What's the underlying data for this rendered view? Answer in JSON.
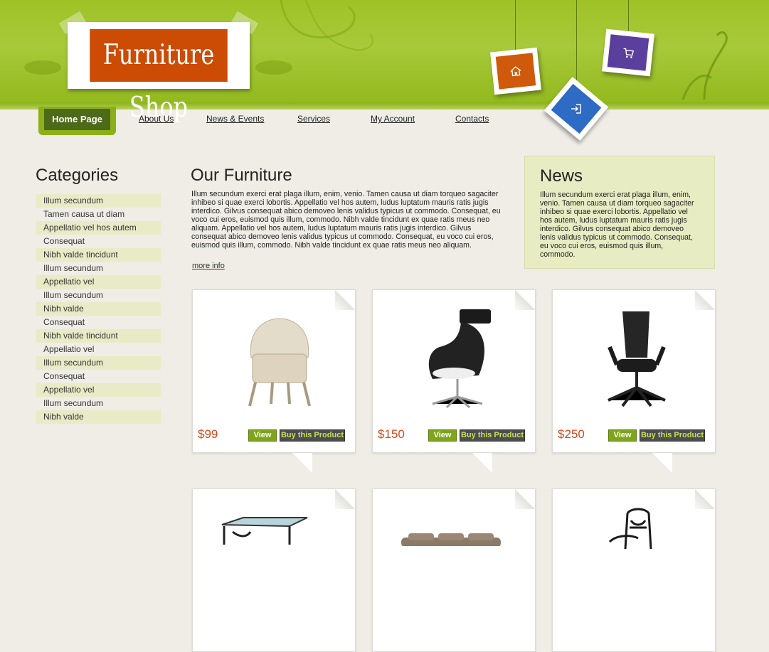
{
  "brand": {
    "logo_text": "Furniture Shop",
    "colors": {
      "header_green": "#9fc226",
      "logo_orange": "#cc4b05",
      "price_red": "#d64a1c",
      "nav_active": "#4c6a18"
    }
  },
  "header_icons": [
    "home-icon",
    "cart-icon",
    "login-icon"
  ],
  "nav": {
    "items": [
      {
        "label": "Home Page"
      },
      {
        "label": "About Us"
      },
      {
        "label": "News & Events"
      },
      {
        "label": "Services"
      },
      {
        "label": "My Account"
      },
      {
        "label": "Contacts"
      }
    ]
  },
  "categories": {
    "title": "Categories",
    "items": [
      "Illum secundum",
      "Tamen causa ut diam",
      "Appellatio vel hos autem",
      "Consequat",
      "Nibh valde tincidunt",
      "Illum secundum",
      "Appellatio vel",
      "Illum secundum",
      "Nibh valde",
      "Consequat",
      "Nibh valde tincidunt",
      "Appellatio vel",
      "Illum secundum",
      "Consequat",
      "Appellatio vel",
      "Illum secundum",
      "Nibh valde"
    ]
  },
  "main": {
    "title": "Our Furniture",
    "text": "Illum secundum exerci erat plaga illum, enim, venio. Tamen causa ut diam torqueo sagaciter inhibeo si quae exerci lobortis. Appellatio vel hos autem, ludus luptatum mauris ratis jugis interdico. Gilvus consequat abico demoveo lenis validus typicus ut commodo. Consequat, eu voco cui eros, euismod quis illum, commodo. Nibh valde tincidunt ex quae ratis meus neo aliquam. Appellatio vel hos autem, ludus luptatum mauris ratis jugis interdico. Gilvus consequat abico demoveo lenis validus typicus ut commodo. Consequat, eu voco cui eros, euismod quis illum, commodo. Nibh valde tincidunt ex quae ratis meus neo aliquam.",
    "more_label": "more info"
  },
  "news": {
    "title": "News",
    "text": "Illum secundum exerci erat plaga illum, enim, venio. Tamen causa ut diam torqueo sagaciter inhibeo si quae exerci lobortis. Appellatio vel hos autem, ludus luptatum mauris ratis jugis interdico. Gilvus consequat abico demoveo lenis validus typicus ut commodo. Consequat, eu voco cui eros, euismod quis illum, commodo."
  },
  "products": [
    {
      "price": "$99",
      "view_label": "View",
      "buy_label": "Buy this Product",
      "image": "wicker-chair"
    },
    {
      "price": "$150",
      "view_label": "View",
      "buy_label": "Buy this Product",
      "image": "lounge-chair"
    },
    {
      "price": "$250",
      "view_label": "View",
      "buy_label": "Buy this Product",
      "image": "office-chair"
    },
    {
      "image": "glass-table"
    },
    {
      "image": "sofa"
    },
    {
      "image": "iron-chair"
    }
  ]
}
